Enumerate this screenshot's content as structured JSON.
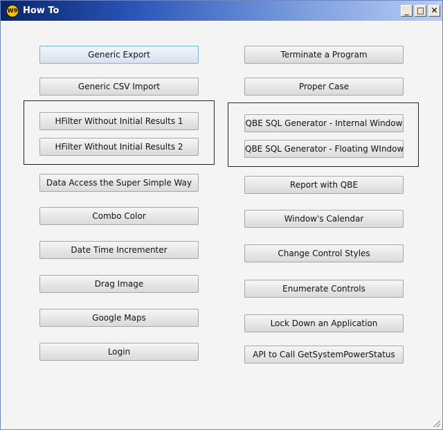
{
  "window": {
    "title": "How To",
    "icon_name": "app-logo-icon",
    "icon_text": "W9",
    "controls": {
      "minimize": "_",
      "maximize": "□",
      "close": "✕"
    }
  },
  "left_buttons": [
    "Generic Export",
    "Generic CSV Import",
    "HFilter Without Initial Results 1",
    "HFilter Without Initial Results 2",
    "Data Access the Super Simple Way",
    "Combo Color",
    "Date Time Incrementer",
    "Drag Image",
    "Google Maps",
    "Login"
  ],
  "right_buttons": [
    "Terminate a Program",
    "Proper Case",
    "QBE SQL Generator - Internal Window",
    "QBE SQL Generator - Floating WIndow",
    "Report with QBE",
    "Window's Calendar",
    "Change Control Styles",
    "Enumerate Controls",
    "Lock Down an Application",
    "API to Call GetSystemPowerStatus"
  ]
}
